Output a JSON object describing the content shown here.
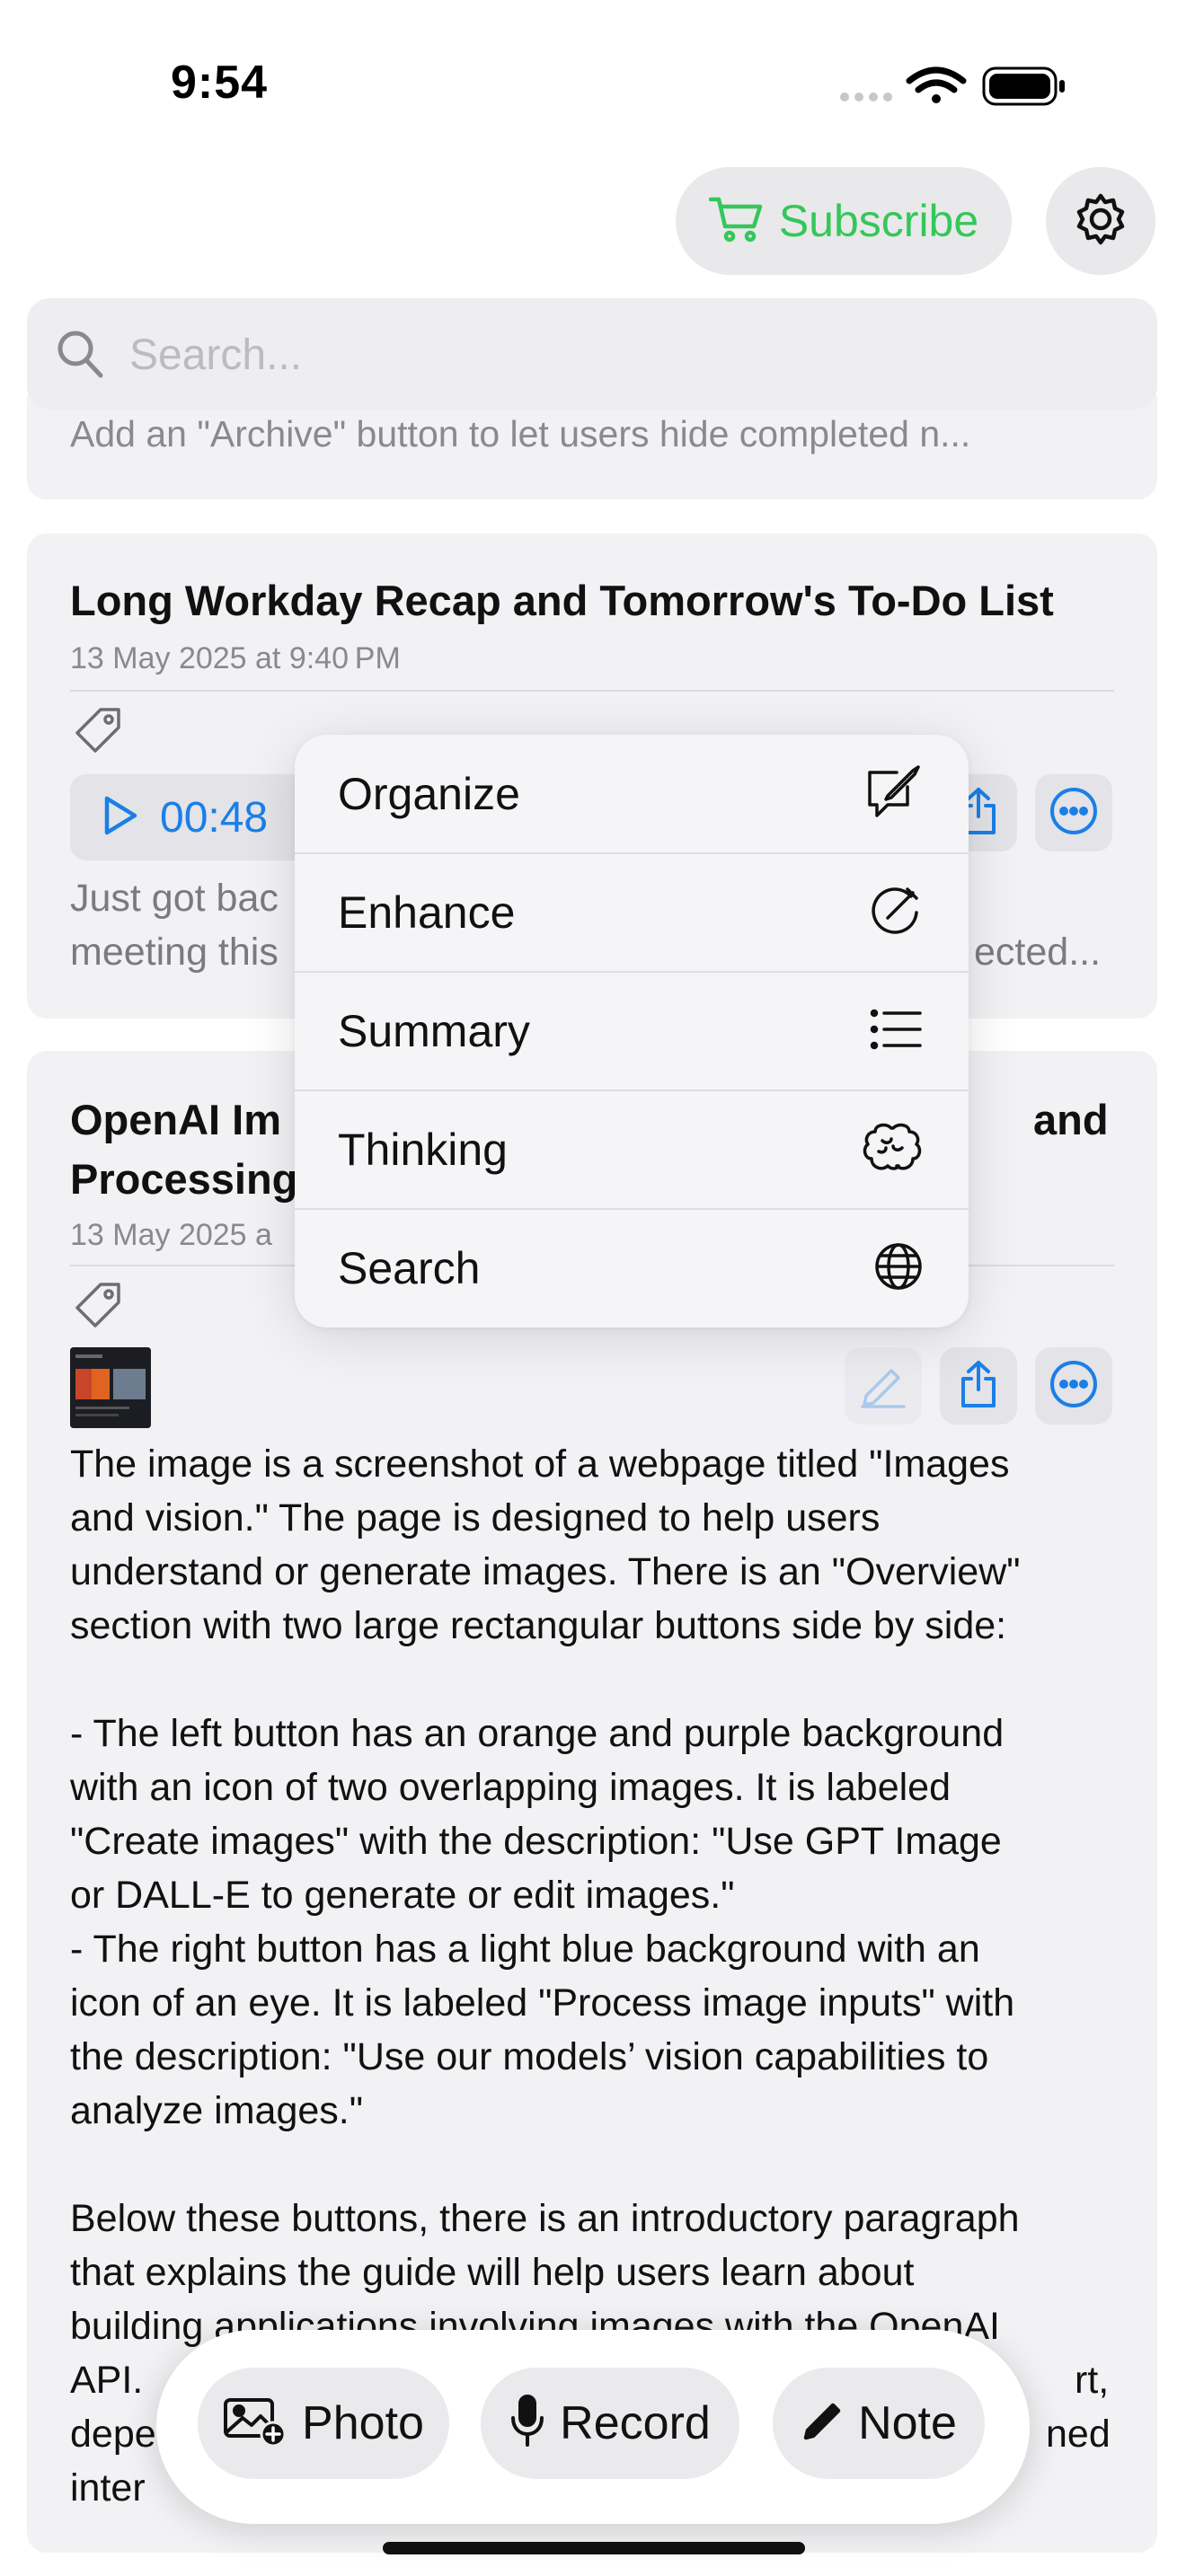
{
  "status_bar": {
    "time": "9:54"
  },
  "header": {
    "subscribe_label": "Subscribe",
    "accent": "#34c759"
  },
  "search": {
    "placeholder": "Search..."
  },
  "previous_card": {
    "snippet": "Add an \"Archive\" button to let users hide completed n..."
  },
  "card1": {
    "title": "Long Workday Recap and Tomorrow's To-Do List",
    "date": "13 May 2025 at 9:40 PM",
    "duration": "00:48",
    "body_line1_left": "Just got bac",
    "body_line2_left": "meeting this",
    "body_line2_right": "ected..."
  },
  "card2": {
    "title_line1_left": "OpenAI Im",
    "title_line1_right": "and",
    "title_line2_left": "Processing",
    "date_left": "13 May 2025 a",
    "paragraphs": [
      "The image is a screenshot of a webpage titled \"Images",
      "and vision.\" The page is designed to help users",
      "understand or generate images. There is an \"Overview\"",
      "section with two large rectangular buttons side by side:",
      "",
      "- The left button has an orange and purple background",
      "with an icon of two overlapping images. It is labeled",
      "\"Create images\" with the description: \"Use GPT Image",
      "or DALL-E to generate or edit images.\"",
      "- The right button has a light blue background with an",
      "icon of an eye. It is labeled \"Process image inputs\" with",
      "the description: \"Use our models’ vision capabilities to",
      "analyze images.\"",
      "",
      "Below these buttons, there is an introductory paragraph",
      "that explains the guide will help users learn about",
      "building applications involving images with the OpenAI"
    ],
    "tail_lines": [
      {
        "left": "API. ",
        "right": "rt,"
      },
      {
        "left": "depe",
        "right": "ned"
      },
      {
        "left": "inter",
        "right": ""
      }
    ]
  },
  "context_menu": {
    "items": [
      {
        "label": "Organize",
        "icon": "compose-icon"
      },
      {
        "label": "Enhance",
        "icon": "enhance-icon"
      },
      {
        "label": "Summary",
        "icon": "list-icon"
      },
      {
        "label": "Thinking",
        "icon": "brain-icon"
      },
      {
        "label": "Search",
        "icon": "globe-icon"
      }
    ]
  },
  "bottom_bar": {
    "photo_label": "Photo",
    "record_label": "Record",
    "note_label": "Note"
  },
  "colors": {
    "link_blue": "#1a7fe6",
    "card_bg": "#f2f2f4"
  }
}
